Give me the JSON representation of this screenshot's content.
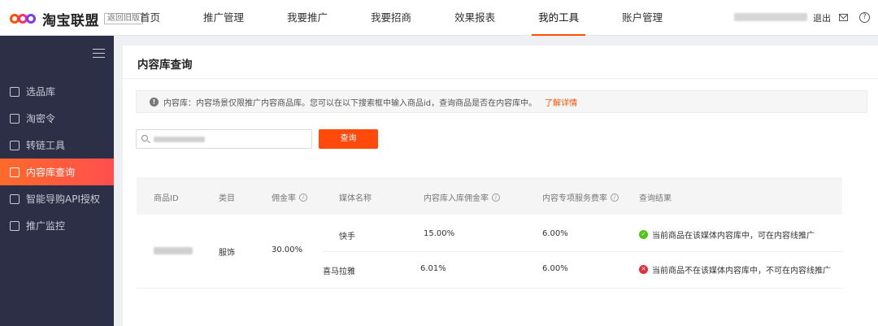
{
  "header": {
    "brand": "淘宝联盟",
    "old_version": "返回旧版",
    "nav": [
      {
        "label": "首页"
      },
      {
        "label": "推广管理"
      },
      {
        "label": "我要推广"
      },
      {
        "label": "我要招商"
      },
      {
        "label": "效果报表"
      },
      {
        "label": "我的工具"
      },
      {
        "label": "账户管理"
      }
    ],
    "active_nav": "我的工具",
    "logout": "退出",
    "accent_color": "#ff5000"
  },
  "sidebar": {
    "items": [
      {
        "label": "选品库",
        "icon": "home-icon"
      },
      {
        "label": "淘密令",
        "icon": "chart-icon"
      },
      {
        "label": "转链工具",
        "icon": "link-icon"
      },
      {
        "label": "内容库查询",
        "icon": "search-doc-icon"
      },
      {
        "label": "智能导购API授权",
        "icon": "chat-icon"
      },
      {
        "label": "推广监控",
        "icon": "monitor-icon"
      }
    ],
    "active": "内容库查询"
  },
  "page": {
    "title": "内容库查询",
    "notice": "内容库：内容场景仅限推广内容商品库。您可以在以下搜索框中输入商品id，查询商品是否在内容库中。",
    "notice_link": "了解详情",
    "search_button": "查询"
  },
  "table": {
    "headers": [
      "商品ID",
      "类目",
      "佣金率",
      "媒体名称",
      "内容库入库佣金率",
      "内容专项服务费率",
      "查询结果"
    ],
    "category": "服饰",
    "commission": "30.00%",
    "rows": [
      {
        "media": "快手",
        "rate": "15.00%",
        "fee": "6.00%",
        "result": "当前商品在该媒体内容库中，可在内容线推广",
        "status": "ok"
      },
      {
        "media": "喜马拉雅",
        "rate": "6.01%",
        "fee": "6.00%",
        "result": "当前商品不在该媒体内容库中，不可在内容线推广",
        "status": "error"
      }
    ]
  }
}
